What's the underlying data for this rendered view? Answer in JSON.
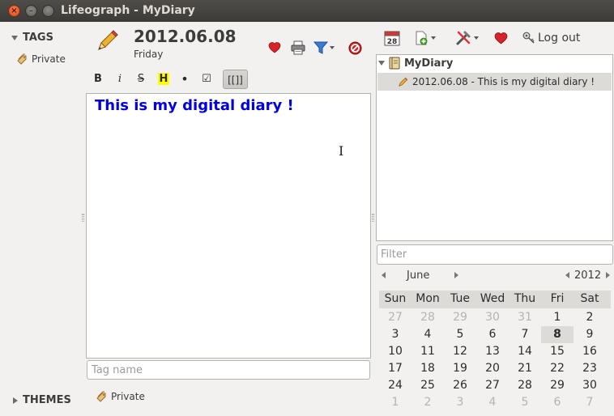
{
  "window": {
    "title": "Lifeograph - MyDiary"
  },
  "sidebar": {
    "tags_header": "TAGS",
    "tags": [
      {
        "label": "Private"
      }
    ],
    "themes_header": "THEMES"
  },
  "entry": {
    "date": "2012.06.08",
    "weekday": "Friday",
    "text": "This is my digital diary !",
    "tag_placeholder": "Tag name",
    "tags": [
      {
        "label": "Private"
      }
    ]
  },
  "format_toolbar": {
    "bold": "B",
    "italic": "i",
    "strike": "S",
    "highlight": "H",
    "bullet": "•",
    "check": "☑",
    "link": "[[]]"
  },
  "right_toolbar": {
    "calendar_day": "28",
    "logout_label": "Log out"
  },
  "tree": {
    "root": "MyDiary",
    "entries": [
      {
        "label": "2012.06.08 -  This is my digital diary !"
      }
    ]
  },
  "filter": {
    "placeholder": "Filter"
  },
  "calendar": {
    "month": "June",
    "year": "2012",
    "weekdays": [
      "Sun",
      "Mon",
      "Tue",
      "Wed",
      "Thu",
      "Fri",
      "Sat"
    ],
    "weeks": [
      [
        "27",
        "28",
        "29",
        "30",
        "31",
        "1",
        "2"
      ],
      [
        "3",
        "4",
        "5",
        "6",
        "7",
        "8",
        "9"
      ],
      [
        "10",
        "11",
        "12",
        "13",
        "14",
        "15",
        "16"
      ],
      [
        "17",
        "18",
        "19",
        "20",
        "21",
        "22",
        "23"
      ],
      [
        "24",
        "25",
        "26",
        "27",
        "28",
        "29",
        "30"
      ],
      [
        "1",
        "2",
        "3",
        "4",
        "5",
        "6",
        "7"
      ]
    ],
    "selected_day": "8"
  },
  "colors": {
    "titlebar": "#3c3b37",
    "entry_text": "#0000e0",
    "selection": "#dcdbd8",
    "heart": "#d8232a",
    "stop": "#cc0000"
  }
}
